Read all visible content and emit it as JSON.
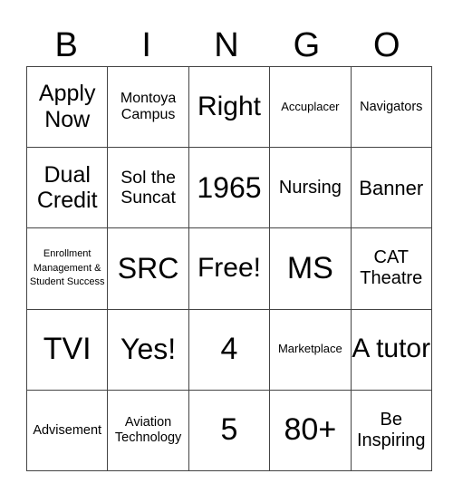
{
  "header": {
    "letters": [
      "B",
      "I",
      "N",
      "G",
      "O"
    ]
  },
  "board": {
    "rows": [
      [
        "Apply Now",
        "Montoya Campus",
        "Right",
        "Accuplacer",
        "Navigators"
      ],
      [
        "Dual Credit",
        "Sol the Suncat",
        "1965",
        "Nursing",
        "Banner"
      ],
      [
        "Enrollment Management & Student Success",
        "SRC",
        "Free!",
        "MS",
        "CAT Theatre"
      ],
      [
        "TVI",
        "Yes!",
        "4",
        "Marketplace",
        "A tutor"
      ],
      [
        "Advisement",
        "Aviation Technology",
        "5",
        "80+",
        "Be Inspiring"
      ]
    ]
  }
}
